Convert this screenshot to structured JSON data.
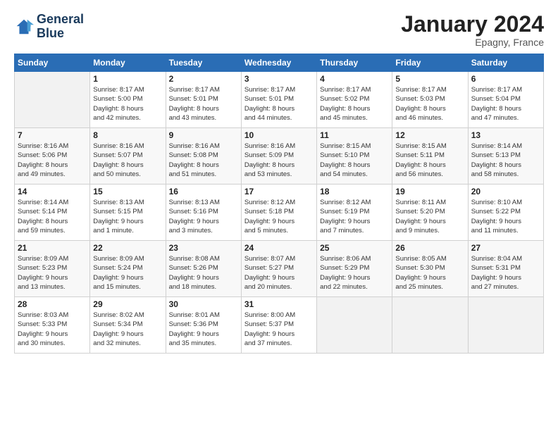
{
  "logo": {
    "line1": "General",
    "line2": "Blue"
  },
  "title": "January 2024",
  "subtitle": "Epagny, France",
  "header_days": [
    "Sunday",
    "Monday",
    "Tuesday",
    "Wednesday",
    "Thursday",
    "Friday",
    "Saturday"
  ],
  "weeks": [
    [
      {
        "num": "",
        "sunrise": "",
        "sunset": "",
        "daylight": ""
      },
      {
        "num": "1",
        "sunrise": "Sunrise: 8:17 AM",
        "sunset": "Sunset: 5:00 PM",
        "daylight": "Daylight: 8 hours and 42 minutes."
      },
      {
        "num": "2",
        "sunrise": "Sunrise: 8:17 AM",
        "sunset": "Sunset: 5:01 PM",
        "daylight": "Daylight: 8 hours and 43 minutes."
      },
      {
        "num": "3",
        "sunrise": "Sunrise: 8:17 AM",
        "sunset": "Sunset: 5:01 PM",
        "daylight": "Daylight: 8 hours and 44 minutes."
      },
      {
        "num": "4",
        "sunrise": "Sunrise: 8:17 AM",
        "sunset": "Sunset: 5:02 PM",
        "daylight": "Daylight: 8 hours and 45 minutes."
      },
      {
        "num": "5",
        "sunrise": "Sunrise: 8:17 AM",
        "sunset": "Sunset: 5:03 PM",
        "daylight": "Daylight: 8 hours and 46 minutes."
      },
      {
        "num": "6",
        "sunrise": "Sunrise: 8:17 AM",
        "sunset": "Sunset: 5:04 PM",
        "daylight": "Daylight: 8 hours and 47 minutes."
      }
    ],
    [
      {
        "num": "7",
        "sunrise": "Sunrise: 8:16 AM",
        "sunset": "Sunset: 5:06 PM",
        "daylight": "Daylight: 8 hours and 49 minutes."
      },
      {
        "num": "8",
        "sunrise": "Sunrise: 8:16 AM",
        "sunset": "Sunset: 5:07 PM",
        "daylight": "Daylight: 8 hours and 50 minutes."
      },
      {
        "num": "9",
        "sunrise": "Sunrise: 8:16 AM",
        "sunset": "Sunset: 5:08 PM",
        "daylight": "Daylight: 8 hours and 51 minutes."
      },
      {
        "num": "10",
        "sunrise": "Sunrise: 8:16 AM",
        "sunset": "Sunset: 5:09 PM",
        "daylight": "Daylight: 8 hours and 53 minutes."
      },
      {
        "num": "11",
        "sunrise": "Sunrise: 8:15 AM",
        "sunset": "Sunset: 5:10 PM",
        "daylight": "Daylight: 8 hours and 54 minutes."
      },
      {
        "num": "12",
        "sunrise": "Sunrise: 8:15 AM",
        "sunset": "Sunset: 5:11 PM",
        "daylight": "Daylight: 8 hours and 56 minutes."
      },
      {
        "num": "13",
        "sunrise": "Sunrise: 8:14 AM",
        "sunset": "Sunset: 5:13 PM",
        "daylight": "Daylight: 8 hours and 58 minutes."
      }
    ],
    [
      {
        "num": "14",
        "sunrise": "Sunrise: 8:14 AM",
        "sunset": "Sunset: 5:14 PM",
        "daylight": "Daylight: 8 hours and 59 minutes."
      },
      {
        "num": "15",
        "sunrise": "Sunrise: 8:13 AM",
        "sunset": "Sunset: 5:15 PM",
        "daylight": "Daylight: 9 hours and 1 minute."
      },
      {
        "num": "16",
        "sunrise": "Sunrise: 8:13 AM",
        "sunset": "Sunset: 5:16 PM",
        "daylight": "Daylight: 9 hours and 3 minutes."
      },
      {
        "num": "17",
        "sunrise": "Sunrise: 8:12 AM",
        "sunset": "Sunset: 5:18 PM",
        "daylight": "Daylight: 9 hours and 5 minutes."
      },
      {
        "num": "18",
        "sunrise": "Sunrise: 8:12 AM",
        "sunset": "Sunset: 5:19 PM",
        "daylight": "Daylight: 9 hours and 7 minutes."
      },
      {
        "num": "19",
        "sunrise": "Sunrise: 8:11 AM",
        "sunset": "Sunset: 5:20 PM",
        "daylight": "Daylight: 9 hours and 9 minutes."
      },
      {
        "num": "20",
        "sunrise": "Sunrise: 8:10 AM",
        "sunset": "Sunset: 5:22 PM",
        "daylight": "Daylight: 9 hours and 11 minutes."
      }
    ],
    [
      {
        "num": "21",
        "sunrise": "Sunrise: 8:09 AM",
        "sunset": "Sunset: 5:23 PM",
        "daylight": "Daylight: 9 hours and 13 minutes."
      },
      {
        "num": "22",
        "sunrise": "Sunrise: 8:09 AM",
        "sunset": "Sunset: 5:24 PM",
        "daylight": "Daylight: 9 hours and 15 minutes."
      },
      {
        "num": "23",
        "sunrise": "Sunrise: 8:08 AM",
        "sunset": "Sunset: 5:26 PM",
        "daylight": "Daylight: 9 hours and 18 minutes."
      },
      {
        "num": "24",
        "sunrise": "Sunrise: 8:07 AM",
        "sunset": "Sunset: 5:27 PM",
        "daylight": "Daylight: 9 hours and 20 minutes."
      },
      {
        "num": "25",
        "sunrise": "Sunrise: 8:06 AM",
        "sunset": "Sunset: 5:29 PM",
        "daylight": "Daylight: 9 hours and 22 minutes."
      },
      {
        "num": "26",
        "sunrise": "Sunrise: 8:05 AM",
        "sunset": "Sunset: 5:30 PM",
        "daylight": "Daylight: 9 hours and 25 minutes."
      },
      {
        "num": "27",
        "sunrise": "Sunrise: 8:04 AM",
        "sunset": "Sunset: 5:31 PM",
        "daylight": "Daylight: 9 hours and 27 minutes."
      }
    ],
    [
      {
        "num": "28",
        "sunrise": "Sunrise: 8:03 AM",
        "sunset": "Sunset: 5:33 PM",
        "daylight": "Daylight: 9 hours and 30 minutes."
      },
      {
        "num": "29",
        "sunrise": "Sunrise: 8:02 AM",
        "sunset": "Sunset: 5:34 PM",
        "daylight": "Daylight: 9 hours and 32 minutes."
      },
      {
        "num": "30",
        "sunrise": "Sunrise: 8:01 AM",
        "sunset": "Sunset: 5:36 PM",
        "daylight": "Daylight: 9 hours and 35 minutes."
      },
      {
        "num": "31",
        "sunrise": "Sunrise: 8:00 AM",
        "sunset": "Sunset: 5:37 PM",
        "daylight": "Daylight: 9 hours and 37 minutes."
      },
      {
        "num": "",
        "sunrise": "",
        "sunset": "",
        "daylight": ""
      },
      {
        "num": "",
        "sunrise": "",
        "sunset": "",
        "daylight": ""
      },
      {
        "num": "",
        "sunrise": "",
        "sunset": "",
        "daylight": ""
      }
    ]
  ]
}
